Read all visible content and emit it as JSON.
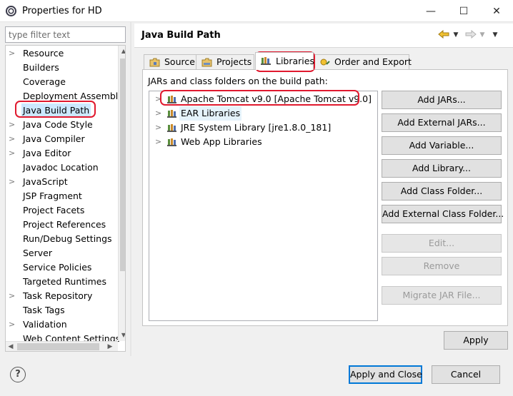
{
  "window": {
    "title": "Properties for HD",
    "minimize_glyph": "—",
    "maximize_glyph": "☐",
    "close_glyph": "✕"
  },
  "filter": {
    "placeholder": "type filter text",
    "value": ""
  },
  "nav_tree": {
    "items": [
      {
        "label": "Resource",
        "expandable": true
      },
      {
        "label": "Builders",
        "expandable": false
      },
      {
        "label": "Coverage",
        "expandable": false
      },
      {
        "label": "Deployment Assembly",
        "expandable": false
      },
      {
        "label": "Java Build Path",
        "expandable": false,
        "selected": true
      },
      {
        "label": "Java Code Style",
        "expandable": true
      },
      {
        "label": "Java Compiler",
        "expandable": true
      },
      {
        "label": "Java Editor",
        "expandable": true
      },
      {
        "label": "Javadoc Location",
        "expandable": false
      },
      {
        "label": "JavaScript",
        "expandable": true
      },
      {
        "label": "JSP Fragment",
        "expandable": false
      },
      {
        "label": "Project Facets",
        "expandable": false
      },
      {
        "label": "Project References",
        "expandable": false
      },
      {
        "label": "Run/Debug Settings",
        "expandable": false
      },
      {
        "label": "Server",
        "expandable": false
      },
      {
        "label": "Service Policies",
        "expandable": false
      },
      {
        "label": "Targeted Runtimes",
        "expandable": false
      },
      {
        "label": "Task Repository",
        "expandable": true
      },
      {
        "label": "Task Tags",
        "expandable": false
      },
      {
        "label": "Validation",
        "expandable": true
      },
      {
        "label": "Web Content Settings",
        "expandable": false
      }
    ]
  },
  "page": {
    "title": "Java Build Path",
    "back_icon": "back-arrow-icon",
    "forward_icon": "forward-arrow-icon",
    "menu_icon": "dropdown-icon"
  },
  "tabs": [
    {
      "label": "Source",
      "icon": "source-folder-icon",
      "active": false
    },
    {
      "label": "Projects",
      "icon": "project-folder-icon",
      "active": false
    },
    {
      "label": "Libraries",
      "icon": "library-icon",
      "active": true
    },
    {
      "label": "Order and Export",
      "icon": "order-export-icon",
      "active": false
    }
  ],
  "libraries": {
    "caption": "JARs and class folders on the build path:",
    "items": [
      {
        "label": "Apache Tomcat v9.0 [Apache Tomcat v9.0]"
      },
      {
        "label": "EAR Libraries",
        "selected": true
      },
      {
        "label": "JRE System Library [jre1.8.0_181]"
      },
      {
        "label": "Web App Libraries"
      }
    ]
  },
  "buttons": {
    "add_jars": "Add JARs...",
    "add_external_jars": "Add External JARs...",
    "add_variable": "Add Variable...",
    "add_library": "Add Library...",
    "add_class_folder": "Add Class Folder...",
    "add_external_class_folder": "Add External Class Folder...",
    "edit": "Edit...",
    "remove": "Remove",
    "migrate_jar": "Migrate JAR File...",
    "apply": "Apply",
    "apply_and_close": "Apply and Close",
    "cancel": "Cancel",
    "help": "?"
  },
  "colors": {
    "highlight_annotation": "#e0192e",
    "selection": "#e5f3fb",
    "focus_border": "#0078d7"
  }
}
